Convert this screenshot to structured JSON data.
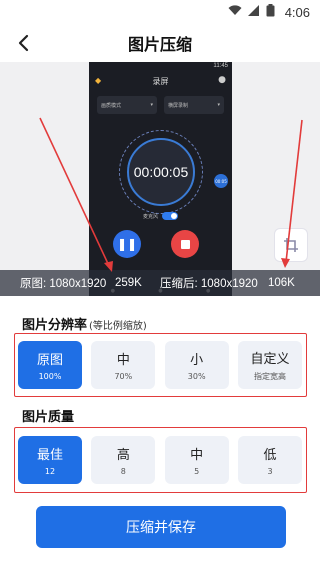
{
  "status_bar": {
    "time": "4:06"
  },
  "header": {
    "title": "图片压缩"
  },
  "preview": {
    "phone": {
      "status_time": "11:45",
      "title": "录屏",
      "select_left": "画质模式",
      "select_right": "横屏录制",
      "timer": "00:00:05",
      "mic_label": "麦克风",
      "badge": "00:05"
    },
    "info": {
      "original_label": "原图: 1080x1920",
      "original_size": "259K",
      "compressed_label": "压缩后: 1080x1920",
      "compressed_size": "106K"
    }
  },
  "resolution": {
    "title": "图片分辨率",
    "note": "(等比例缩放)",
    "options": [
      {
        "main": "原图",
        "sub": "100%"
      },
      {
        "main": "中",
        "sub": "70%"
      },
      {
        "main": "小",
        "sub": "30%"
      },
      {
        "main": "自定义",
        "sub": "指定宽高"
      }
    ]
  },
  "quality": {
    "title": "图片质量",
    "options": [
      {
        "main": "最佳",
        "sub": "12"
      },
      {
        "main": "高",
        "sub": "8"
      },
      {
        "main": "中",
        "sub": "5"
      },
      {
        "main": "低",
        "sub": "3"
      }
    ]
  },
  "action": {
    "label": "压缩并保存"
  },
  "colors": {
    "accent": "#1f6fe5",
    "highlight_box": "#e23b3b",
    "option_bg": "#eef1f7"
  }
}
